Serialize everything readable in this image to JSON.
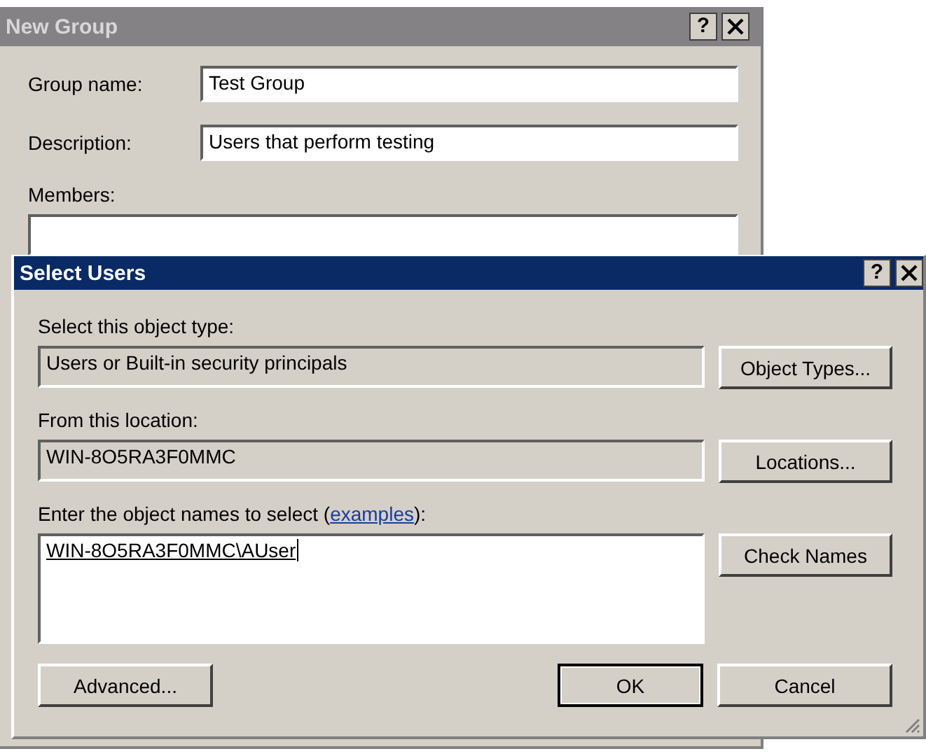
{
  "new_group": {
    "title": "New Group",
    "help": "?",
    "fields": [
      {
        "label": "Group name:",
        "value": "Test Group"
      },
      {
        "label": "Description:",
        "value": "Users that perform testing"
      }
    ],
    "members_label": "Members:"
  },
  "select_users": {
    "title": "Select Users",
    "help": "?",
    "object_type_label": "Select this object type:",
    "object_type": "Users or Built-in security principals",
    "object_types_button": "Object Types...",
    "location_label": "From this location:",
    "location": "WIN-8O5RA3F0MMC",
    "locations_button": "Locations...",
    "names_label": {
      "before": "Enter the object names to select (",
      "link": "examples",
      "after": "):"
    },
    "names_value": "WIN-8O5RA3F0MMC\\AUser",
    "check_names_button": "Check Names",
    "advanced_button": "Advanced...",
    "ok_button": "OK",
    "cancel_button": "Cancel"
  }
}
